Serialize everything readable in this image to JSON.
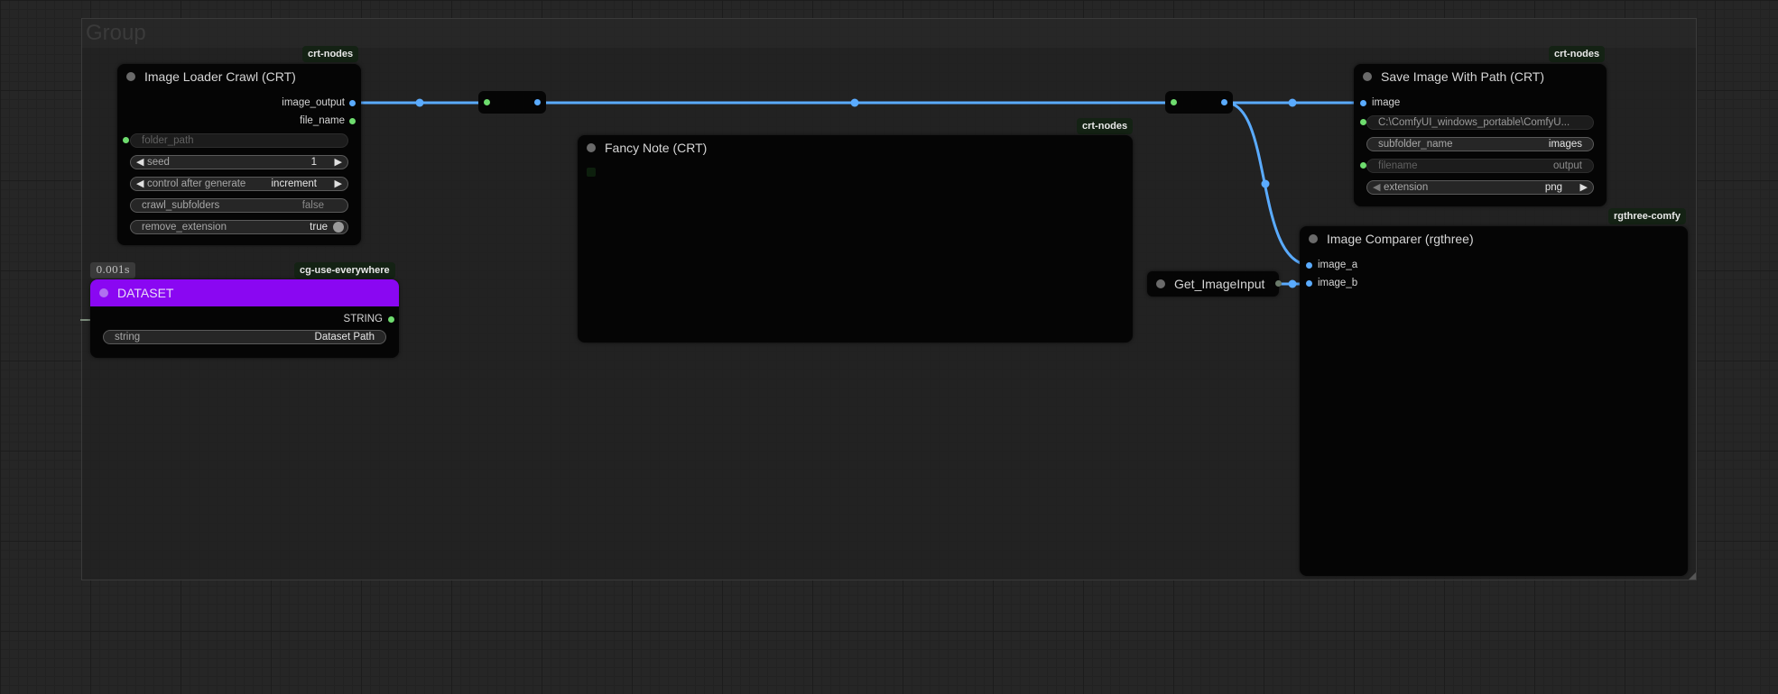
{
  "group": {
    "title": "Group"
  },
  "timer": {
    "text": "0.001s"
  },
  "colors": {
    "link": "#5aabff",
    "dataset_header": "#8a07f2",
    "badge_bg": "#142214"
  },
  "nodes": {
    "image_loader": {
      "badge": "crt-nodes",
      "title": "Image Loader Crawl (CRT)",
      "outputs": [
        "image_output",
        "file_name"
      ],
      "folder_path_placeholder": "folder_path",
      "seed_label": "seed",
      "seed_value": "1",
      "control_label": "control after generate",
      "control_value": "increment",
      "crawl_label": "crawl_subfolders",
      "crawl_value": "false",
      "remove_label": "remove_extension",
      "remove_value": "true"
    },
    "dataset": {
      "badge": "cg-use-everywhere",
      "title": "DATASET",
      "output": "STRING",
      "string_label": "string",
      "string_value": "Dataset Path"
    },
    "fancy_note": {
      "badge": "crt-nodes",
      "title": "Fancy Note (CRT)"
    },
    "save_image": {
      "badge": "crt-nodes",
      "title": "Save Image With Path (CRT)",
      "input": "image",
      "path_value": "C:\\ComfyUI_windows_portable\\ComfyU...",
      "subfolder_label": "subfolder_name",
      "subfolder_value": "images",
      "filename_label": "filename",
      "filename_value": "output",
      "extension_label": "extension",
      "extension_value": "png"
    },
    "get_image_input": {
      "title": "Get_ImageInput"
    },
    "image_comparer": {
      "badge": "rgthree-comfy",
      "title": "Image Comparer (rgthree)",
      "inputs": [
        "image_a",
        "image_b"
      ]
    }
  },
  "icons": {
    "arrow_left": "◀",
    "arrow_right": "▶"
  }
}
